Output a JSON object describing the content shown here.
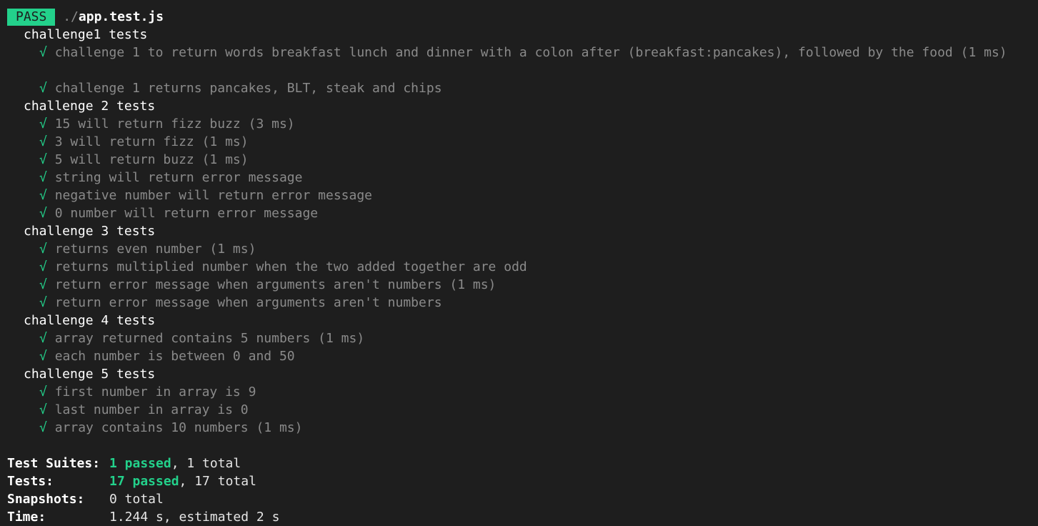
{
  "colors": {
    "background": "#1e1e1e",
    "pass_green": "#23d18b",
    "dim_text": "#8a8a8a",
    "bright_text": "#ffffff"
  },
  "header": {
    "badge": "PASS",
    "path_prefix": "./",
    "path_file": "app.test.js"
  },
  "suites": [
    {
      "title": "challenge1 tests",
      "tests": [
        "challenge 1 to return words breakfast lunch and dinner with a colon after (breakfast:pancakes), followed by the food (1 ms)",
        "challenge 1 returns pancakes, BLT, steak and chips"
      ]
    },
    {
      "title": "challenge 2 tests",
      "tests": [
        "15 will return fizz buzz (3 ms)",
        "3 will return fizz (1 ms)",
        "5 will return buzz (1 ms)",
        "string will return error message",
        "negative number will return error message",
        "0 number will return error message"
      ]
    },
    {
      "title": "challenge 3 tests",
      "tests": [
        "returns even number (1 ms)",
        "returns multiplied number when the two added together are odd",
        "return error message when arguments aren't numbers (1 ms)",
        "return error message when arguments aren't numbers"
      ]
    },
    {
      "title": "challenge 4 tests",
      "tests": [
        "array returned contains 5 numbers (1 ms)",
        "each number is between 0 and 50"
      ]
    },
    {
      "title": "challenge 5 tests",
      "tests": [
        "first number in array is 9",
        "last number in array is 0",
        "array contains 10 numbers (1 ms)"
      ]
    }
  ],
  "check_glyph": "√",
  "summary": {
    "suites_label": "Test Suites:",
    "suites_passed": "1 passed",
    "suites_rest": ", 1 total",
    "tests_label": "Tests:",
    "tests_passed": "17 passed",
    "tests_rest": ", 17 total",
    "snapshots_label": "Snapshots:",
    "snapshots_value": "0 total",
    "time_label": "Time:",
    "time_value": "1.244 s, estimated 2 s"
  }
}
